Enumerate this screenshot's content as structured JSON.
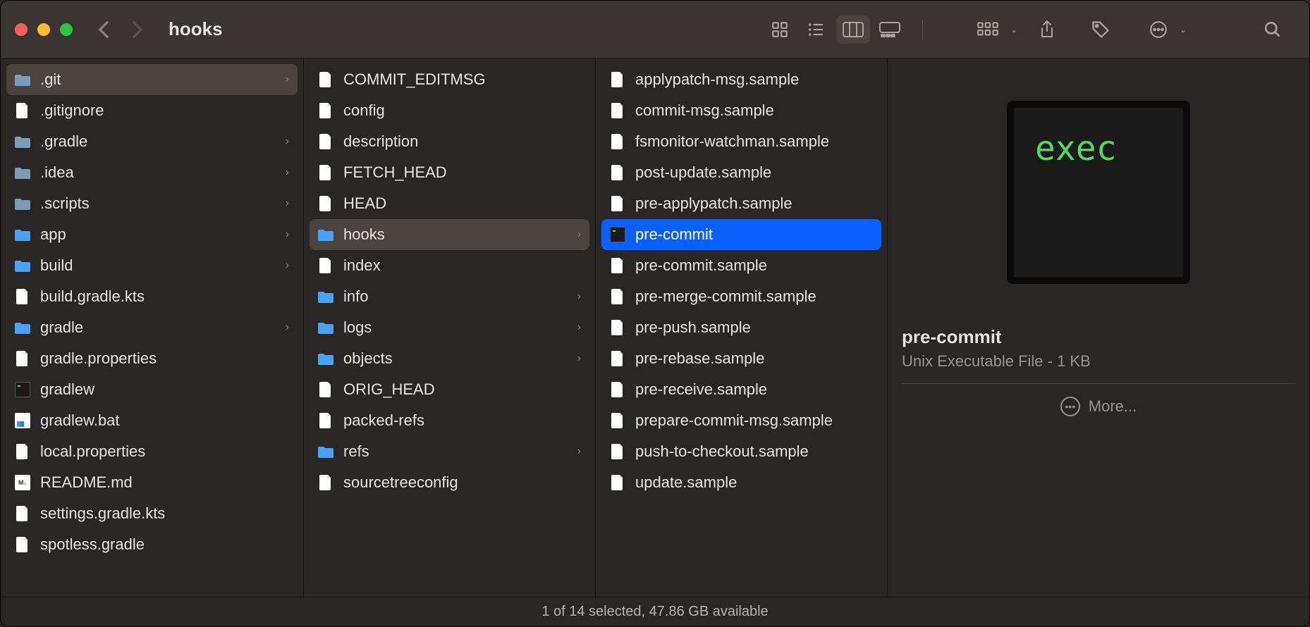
{
  "window": {
    "title": "hooks"
  },
  "columns": {
    "col1": [
      {
        "name": ".git",
        "type": "folder-dim",
        "expandable": true,
        "selected": "dim"
      },
      {
        "name": ".gitignore",
        "type": "file"
      },
      {
        "name": ".gradle",
        "type": "folder-dim",
        "expandable": true
      },
      {
        "name": ".idea",
        "type": "folder-dim",
        "expandable": true
      },
      {
        "name": ".scripts",
        "type": "folder-dim",
        "expandable": true
      },
      {
        "name": "app",
        "type": "folder",
        "expandable": true
      },
      {
        "name": "build",
        "type": "folder",
        "expandable": true
      },
      {
        "name": "build.gradle.kts",
        "type": "file"
      },
      {
        "name": "gradle",
        "type": "folder",
        "expandable": true
      },
      {
        "name": "gradle.properties",
        "type": "file"
      },
      {
        "name": "gradlew",
        "type": "exec"
      },
      {
        "name": "gradlew.bat",
        "type": "bat"
      },
      {
        "name": "local.properties",
        "type": "file"
      },
      {
        "name": "README.md",
        "type": "md"
      },
      {
        "name": "settings.gradle.kts",
        "type": "file"
      },
      {
        "name": "spotless.gradle",
        "type": "file"
      }
    ],
    "col2": [
      {
        "name": "COMMIT_EDITMSG",
        "type": "file"
      },
      {
        "name": "config",
        "type": "file"
      },
      {
        "name": "description",
        "type": "file"
      },
      {
        "name": "FETCH_HEAD",
        "type": "file"
      },
      {
        "name": "HEAD",
        "type": "file"
      },
      {
        "name": "hooks",
        "type": "folder",
        "expandable": true,
        "selected": "dim"
      },
      {
        "name": "index",
        "type": "file"
      },
      {
        "name": "info",
        "type": "folder",
        "expandable": true
      },
      {
        "name": "logs",
        "type": "folder",
        "expandable": true
      },
      {
        "name": "objects",
        "type": "folder",
        "expandable": true
      },
      {
        "name": "ORIG_HEAD",
        "type": "file"
      },
      {
        "name": "packed-refs",
        "type": "file"
      },
      {
        "name": "refs",
        "type": "folder",
        "expandable": true
      },
      {
        "name": "sourcetreeconfig",
        "type": "file"
      }
    ],
    "col3": [
      {
        "name": "applypatch-msg.sample",
        "type": "file"
      },
      {
        "name": "commit-msg.sample",
        "type": "file"
      },
      {
        "name": "fsmonitor-watchman.sample",
        "type": "file"
      },
      {
        "name": "post-update.sample",
        "type": "file"
      },
      {
        "name": "pre-applypatch.sample",
        "type": "file"
      },
      {
        "name": "pre-commit",
        "type": "exec",
        "selected": "blue"
      },
      {
        "name": "pre-commit.sample",
        "type": "file"
      },
      {
        "name": "pre-merge-commit.sample",
        "type": "file"
      },
      {
        "name": "pre-push.sample",
        "type": "file"
      },
      {
        "name": "pre-rebase.sample",
        "type": "file"
      },
      {
        "name": "pre-receive.sample",
        "type": "file"
      },
      {
        "name": "prepare-commit-msg.sample",
        "type": "file"
      },
      {
        "name": "push-to-checkout.sample",
        "type": "file"
      },
      {
        "name": "update.sample",
        "type": "file"
      }
    ]
  },
  "preview": {
    "thumb_text": "exec",
    "name": "pre-commit",
    "meta": "Unix Executable File - 1 KB",
    "more_label": "More..."
  },
  "status": "1 of 14 selected, 47.86 GB available"
}
